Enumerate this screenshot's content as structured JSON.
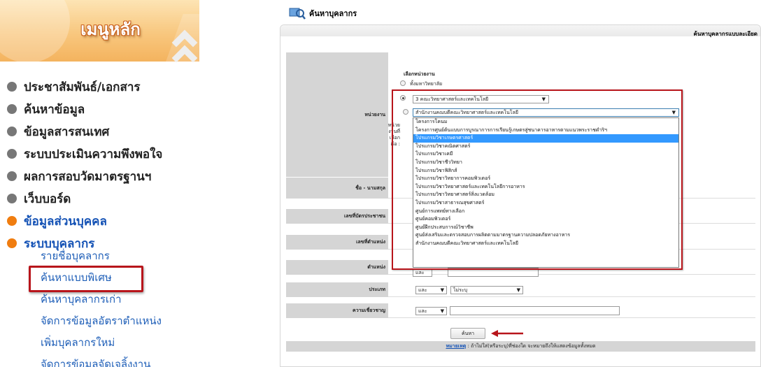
{
  "sidebar": {
    "banner_title": "เมนูหลัก",
    "menu": [
      {
        "label": "ประชาสัมพันธ์/เอกสาร",
        "active": false
      },
      {
        "label": "ค้นหาข้อมูล",
        "active": false
      },
      {
        "label": "ข้อมูลสารสนเทศ",
        "active": false
      },
      {
        "label": "ระบบประเมินความพึงพอใจ",
        "active": false
      },
      {
        "label": "ผลการสอบวัดมาตรฐานฯ",
        "active": false
      },
      {
        "label": "เว็บบอร์ด",
        "active": false
      },
      {
        "label": "ข้อมูลส่วนบุคคล",
        "active": true
      },
      {
        "label": "ระบบบุคลากร",
        "active": true
      }
    ],
    "submenu": [
      {
        "label": "รายชื่อบุคลากร"
      },
      {
        "label": "ค้นหาแบบพิเศษ",
        "highlighted": true
      },
      {
        "label": "ค้นหาบุคลากรเก่า"
      },
      {
        "label": "จัดการข้อมูลอัตราตำแหน่ง"
      },
      {
        "label": "เพิ่มบุคลากรใหม่"
      },
      {
        "label": "จัดการข้อมูลจัดเจลิ้งงาน"
      }
    ]
  },
  "header": {
    "title": "ค้นหาบุคลากร",
    "detailed_search_link": "ค้นหาบุคลากรแบบละเอียด"
  },
  "form": {
    "unit": {
      "label": "หน่วยงาน",
      "heading": "เลือกหน่วยงาน",
      "radio_all": "ทั้งมหาวิทยาลัย",
      "faculty_value": "3 คณะวิทยาศาสตร์และเทคโนโลยี",
      "department_value": "สำนักงานคณบดีคณะวิทยาศาสตร์และเทคโนโลยี",
      "side_note": [
        "หน่วย",
        "งานที่",
        "เลือก",
        "คือ :"
      ]
    },
    "dropdown_options": [
      "โครงการโคนม",
      "โครงการศูนย์ต้นแบบการบูรณาการการเรียนรู้เกษตรสู่ชนาคารอาหารตามแนวพระราชดำริฯ",
      "โปรแกรมวิชาเกษตรศาสตร์",
      "โปรแกรมวิชาคณิตศาสตร์",
      "โปรแกรมวิชาเคมี",
      "โปรแกรมวิชาชีววิทยา",
      "โปรแกรมวิชาฟิสิกส์",
      "โปรแกรมวิชาวิทยาการคอมพิวเตอร์",
      "โปรแกรมวิชาวิทยาศาสตร์และเทคโนโลยีการอาหาร",
      "โปรแกรมวิชาวิทยาศาสตร์สิ่งแวดล้อม",
      "โปรแกรมวิชาสาธารณสุขศาสตร์",
      "ศูนย์การแพทย์ทางเลือก",
      "ศูนย์คอมพิวเตอร์",
      "ศูนย์ฝึกประสบการณ์วิชาชีพ",
      "ศูนย์ส่งเสริมและตรวจสอบการผลิตตามมาตรฐานความปลอดภัยทางอาหาร",
      "สำนักงานคณบดีคณะวิทยาศาสตร์และเทคโนโลยี"
    ],
    "selected_option_index": 2,
    "fields": [
      {
        "label": "ชื่อ - นามสกุล"
      },
      {
        "label": "เลขที่บัตรประชาชน"
      },
      {
        "label": "เลขที่ตำแหน่ง"
      },
      {
        "label": "ตำแหน่ง",
        "op": "และ"
      },
      {
        "label": "ประเภท",
        "op": "และ",
        "value": "ไม่ระบุ"
      },
      {
        "label": "ความเชี่ยวชาญ",
        "op": "และ"
      }
    ],
    "search_button": "ค้นหา",
    "note_key": "หมายเหตุ",
    "note_text": " : ถ้าไม่ใส่(หรือระบุ)ที่ช่องใด จะหมายถึงให้แสดงข้อมูลทั้งหมด"
  },
  "colors": {
    "annotation_red": "#b8151b",
    "menu_orange": "#f07d10",
    "link_blue": "#1f5fb8",
    "selected_blue": "#3399ff"
  }
}
